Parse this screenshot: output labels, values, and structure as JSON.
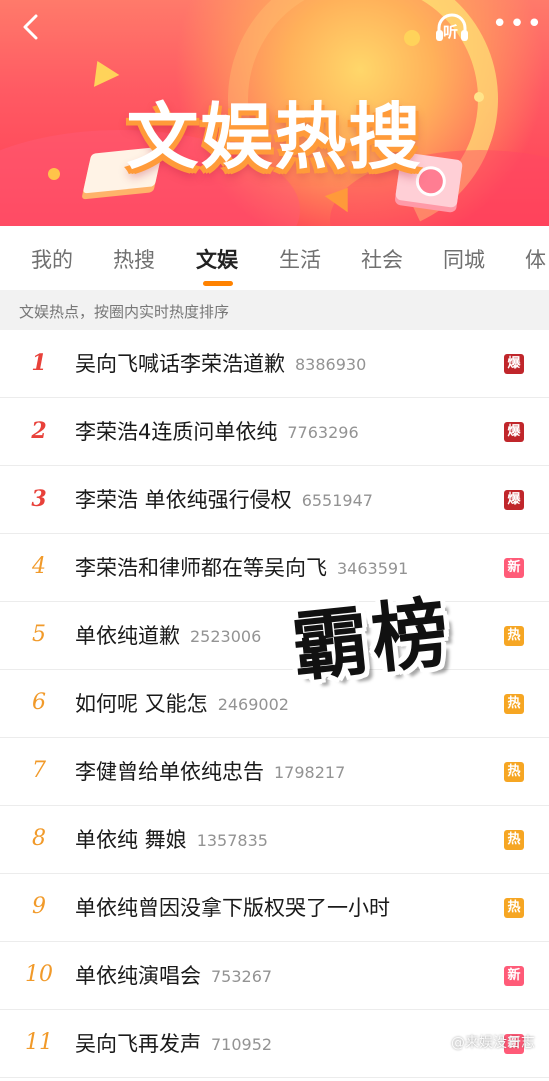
{
  "header": {
    "title": "文娱热搜",
    "listen_label": "听",
    "more_label": "•••"
  },
  "tabs": [
    {
      "label": "我的"
    },
    {
      "label": "热搜"
    },
    {
      "label": "文娱",
      "active": true
    },
    {
      "label": "生活"
    },
    {
      "label": "社会"
    },
    {
      "label": "同城"
    },
    {
      "label": "体"
    }
  ],
  "info": {
    "text": "文娱热点，按圈内实时热度排序"
  },
  "list": [
    {
      "rank": "1",
      "title": "吴向飞喊话李荣浩道歉",
      "count": "8386930",
      "badge": "爆",
      "badge_color": "#c0262b"
    },
    {
      "rank": "2",
      "title": "李荣浩4连质问单依纯",
      "count": "7763296",
      "badge": "爆",
      "badge_color": "#c0262b"
    },
    {
      "rank": "3",
      "title": "李荣浩 单依纯强行侵权",
      "count": "6551947",
      "badge": "爆",
      "badge_color": "#c0262b"
    },
    {
      "rank": "4",
      "title": "李荣浩和律师都在等吴向飞",
      "count": "3463591",
      "badge": "新",
      "badge_color": "#ff5b78"
    },
    {
      "rank": "5",
      "title": "单依纯道歉",
      "count": "2523006",
      "badge": "热",
      "badge_color": "#f6a623"
    },
    {
      "rank": "6",
      "title": "如何呢 又能怎",
      "count": "2469002",
      "badge": "热",
      "badge_color": "#f6a623"
    },
    {
      "rank": "7",
      "title": "李健曾给单依纯忠告",
      "count": "1798217",
      "badge": "热",
      "badge_color": "#f6a623"
    },
    {
      "rank": "8",
      "title": "单依纯 舞娘",
      "count": "1357835",
      "badge": "热",
      "badge_color": "#f6a623"
    },
    {
      "rank": "9",
      "title": "单依纯曾因没拿下版权哭了一小时",
      "count": "",
      "badge": "热",
      "badge_color": "#f6a623"
    },
    {
      "rank": "10",
      "title": "单依纯演唱会",
      "count": "753267",
      "badge": "新",
      "badge_color": "#ff5b78"
    },
    {
      "rank": "11",
      "title": "吴向飞再发声",
      "count": "710952",
      "badge": "新",
      "badge_color": "#ff5b78"
    }
  ],
  "sticker": {
    "text": "霸榜"
  },
  "watermark": {
    "text": "@来娱没日志"
  },
  "colors": {
    "rank_top": "#e8413a",
    "rank_mid": "#f19a2a",
    "tab_underline": "#ff8200",
    "badge_explode": "#c0262b",
    "badge_new": "#ff5b78",
    "badge_hot": "#f6a623"
  }
}
